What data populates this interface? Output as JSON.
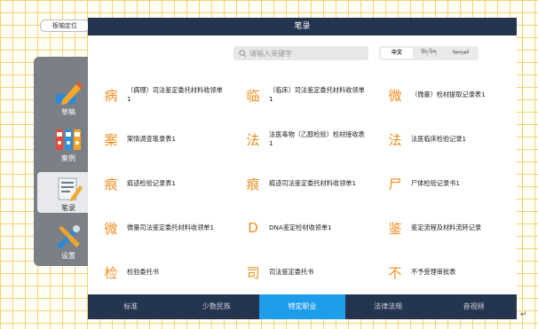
{
  "top_left_button": "板轴定位",
  "header": {
    "title": "笔录"
  },
  "sidebar": {
    "items": [
      {
        "label": "草稿",
        "icon": "pencil-icon",
        "active": false
      },
      {
        "label": "案例",
        "icon": "binders-icon",
        "active": false
      },
      {
        "label": "笔录",
        "icon": "notes-icon",
        "active": true
      },
      {
        "label": "设置",
        "icon": "tools-icon",
        "active": false
      }
    ]
  },
  "search": {
    "placeholder": "请输入关键字"
  },
  "languages": [
    "中文",
    "བོད་ཡིག",
    "ᠮᠣᠩᠭᠣᠯ"
  ],
  "records": [
    {
      "glyph": "病",
      "label": "（病理）司法鉴定委托材料收领单1"
    },
    {
      "glyph": "临",
      "label": "（临床）司法鉴定委托材料收领单1"
    },
    {
      "glyph": "微",
      "label": "（微量）检材提取记录表1"
    },
    {
      "glyph": "案",
      "label": "案情调查笔录表1"
    },
    {
      "glyph": "法",
      "label": "法医毒物（乙醇检验）检材接收表1"
    },
    {
      "glyph": "法",
      "label": "法医临床检验记录1"
    },
    {
      "glyph": "痕",
      "label": "痕迹检验记录表1"
    },
    {
      "glyph": "痕",
      "label": "痕迹司法鉴定委托材料收领单1"
    },
    {
      "glyph": "尸",
      "label": "尸体检验记录书1"
    },
    {
      "glyph": "微",
      "label": "微量司法鉴定委托材料收领单1"
    },
    {
      "glyph": "D",
      "label": "DNA鉴定检材收领单1"
    },
    {
      "glyph": "鉴",
      "label": "鉴定流程及材料流转记录"
    },
    {
      "glyph": "检",
      "label": "检验委托书"
    },
    {
      "glyph": "司",
      "label": "司法鉴定委托书"
    },
    {
      "glyph": "不",
      "label": "不予受理审批表"
    }
  ],
  "tabs": [
    {
      "label": "标准",
      "active": false
    },
    {
      "label": "少数民族",
      "active": false
    },
    {
      "label": "特定职业",
      "active": true
    },
    {
      "label": "法律法规",
      "active": false
    },
    {
      "label": "音视频",
      "active": false
    }
  ],
  "colors": {
    "accent": "#ef8d1f",
    "header": "#25344f",
    "tab_active": "#1e9dea",
    "sidebar": "#7b8086"
  }
}
